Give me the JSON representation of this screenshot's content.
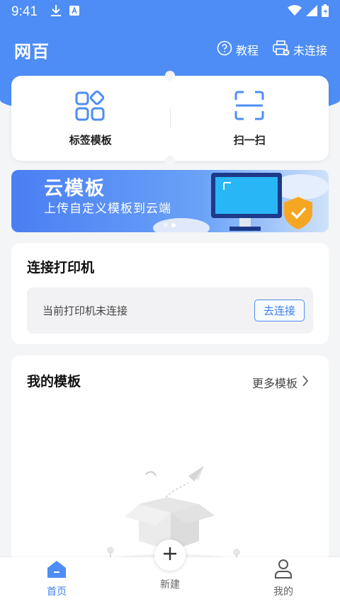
{
  "status_bar": {
    "time": "9:41"
  },
  "header": {
    "app_title": "网百",
    "tutorial_label": "教程",
    "printer_status_label": "未连接"
  },
  "quick_actions": {
    "label_template": "标签模板",
    "scan": "扫一扫"
  },
  "banner": {
    "title": "云模板",
    "subtitle": "上传自定义模板到云端"
  },
  "printer_card": {
    "title": "连接打印机",
    "status_text": "当前打印机未连接",
    "connect_button": "去连接"
  },
  "templates_card": {
    "title": "我的模板",
    "more_link": "更多模板"
  },
  "bottom_nav": {
    "home": "首页",
    "new": "新建",
    "mine": "我的"
  },
  "colors": {
    "primary": "#4d8df5",
    "active_nav": "#3f7ff0",
    "banner_shield": "#f5a623"
  },
  "icons": [
    "download-icon",
    "app-notification-icon",
    "wifi-icon",
    "signal-icon",
    "battery-icon",
    "help-circle-icon",
    "printer-icon",
    "grid-apps-icon",
    "scan-frame-icon",
    "chevron-right-icon",
    "home-icon",
    "plus-icon",
    "user-icon"
  ]
}
